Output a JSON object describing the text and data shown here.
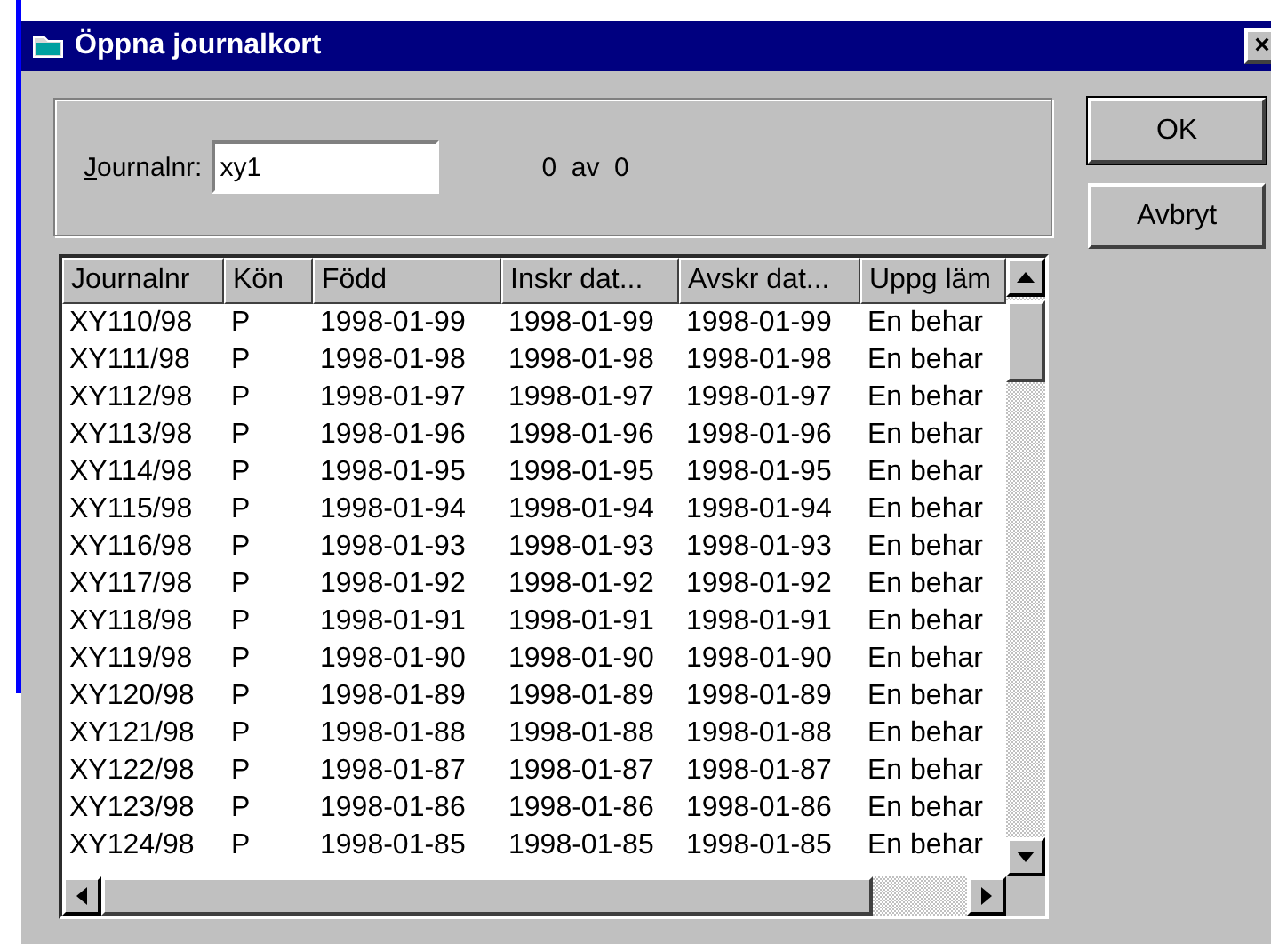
{
  "window": {
    "title": "Öppna journalkort",
    "close": "×"
  },
  "search": {
    "label": "Journalnr:",
    "value": "xy1",
    "count": "0  av  0"
  },
  "buttons": [
    {
      "label": "OK",
      "default": true
    },
    {
      "label": "Avbryt",
      "default": false
    }
  ],
  "table": {
    "columns": [
      "Journalnr",
      "Kön",
      "Född",
      "Inskr dat...",
      "Avskr dat...",
      "Uppg läm"
    ],
    "rows": [
      [
        "XY110/98",
        "P",
        "1998-01-99",
        "1998-01-99",
        "1998-01-99",
        "En behar"
      ],
      [
        "XY111/98",
        "P",
        "1998-01-98",
        "1998-01-98",
        "1998-01-98",
        "En behar"
      ],
      [
        "XY112/98",
        "P",
        "1998-01-97",
        "1998-01-97",
        "1998-01-97",
        "En behar"
      ],
      [
        "XY113/98",
        "P",
        "1998-01-96",
        "1998-01-96",
        "1998-01-96",
        "En behar"
      ],
      [
        "XY114/98",
        "P",
        "1998-01-95",
        "1998-01-95",
        "1998-01-95",
        "En behar"
      ],
      [
        "XY115/98",
        "P",
        "1998-01-94",
        "1998-01-94",
        "1998-01-94",
        "En behar"
      ],
      [
        "XY116/98",
        "P",
        "1998-01-93",
        "1998-01-93",
        "1998-01-93",
        "En behar"
      ],
      [
        "XY117/98",
        "P",
        "1998-01-92",
        "1998-01-92",
        "1998-01-92",
        "En behar"
      ],
      [
        "XY118/98",
        "P",
        "1998-01-91",
        "1998-01-91",
        "1998-01-91",
        "En behar"
      ],
      [
        "XY119/98",
        "P",
        "1998-01-90",
        "1998-01-90",
        "1998-01-90",
        "En behar"
      ],
      [
        "XY120/98",
        "P",
        "1998-01-89",
        "1998-01-89",
        "1998-01-89",
        "En behar"
      ],
      [
        "XY121/98",
        "P",
        "1998-01-88",
        "1998-01-88",
        "1998-01-88",
        "En behar"
      ],
      [
        "XY122/98",
        "P",
        "1998-01-87",
        "1998-01-87",
        "1998-01-87",
        "En behar"
      ],
      [
        "XY123/98",
        "P",
        "1998-01-86",
        "1998-01-86",
        "1998-01-86",
        "En behar"
      ],
      [
        "XY124/98",
        "P",
        "1998-01-85",
        "1998-01-85",
        "1998-01-85",
        "En behar"
      ]
    ]
  }
}
